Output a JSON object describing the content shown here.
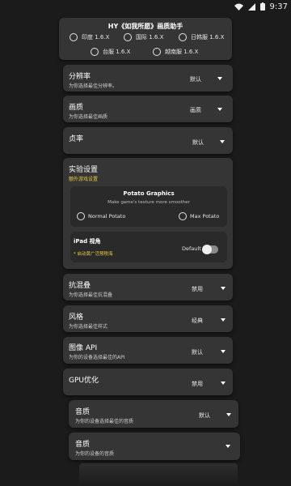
{
  "status_bar": {
    "time": "9:37"
  },
  "header": {
    "title": "HY《如我所愿》画质助手",
    "regions": [
      {
        "label": "印度 1.6.X"
      },
      {
        "label": "国际 1.6.X"
      },
      {
        "label": "日韩服 1.6.X"
      },
      {
        "label": "台服 1.6.X"
      },
      {
        "label": "越南服 1.6.X"
      }
    ]
  },
  "resolution": {
    "title": "分辨率",
    "subtitle": "为你选择最佳分辨率。",
    "value": "默认"
  },
  "quality": {
    "title": "画质",
    "subtitle": "为你选择最佳画质",
    "value": "画质"
  },
  "framerate": {
    "title": "贞率",
    "value": "默认"
  },
  "experimental": {
    "title": "实验设置",
    "subtitle": "额外游戏设置",
    "accent": "#e8c840",
    "potato": {
      "title": "Potato Graphics",
      "subtitle": "Make game's texture more smoother",
      "normal_label": "Normal Potato",
      "max_label": "Max Potato"
    },
    "ipad": {
      "title": "iPad 视角",
      "note": "* 启动黄广活预税海",
      "toggle_label": "Default",
      "toggle_on": false
    }
  },
  "antialias": {
    "title": "抗混叠",
    "subtitle": "为你选择最佳抗混叠",
    "value": "禁用"
  },
  "style": {
    "title": "风格",
    "subtitle": "为你选择最佳样式",
    "value": "经典"
  },
  "graphics_api": {
    "title": "图像 API",
    "subtitle": "为你的设备选择最佳的API",
    "value": "默认"
  },
  "gpu": {
    "title": "GPU优化",
    "value": "禁用"
  },
  "sound_quality": {
    "title": "音质",
    "subtitle": "为你的设备选择最佳的音质",
    "value": "默认"
  },
  "sound_quality_2": {
    "title": "音质",
    "subtitle": "为你的设备的音质"
  }
}
